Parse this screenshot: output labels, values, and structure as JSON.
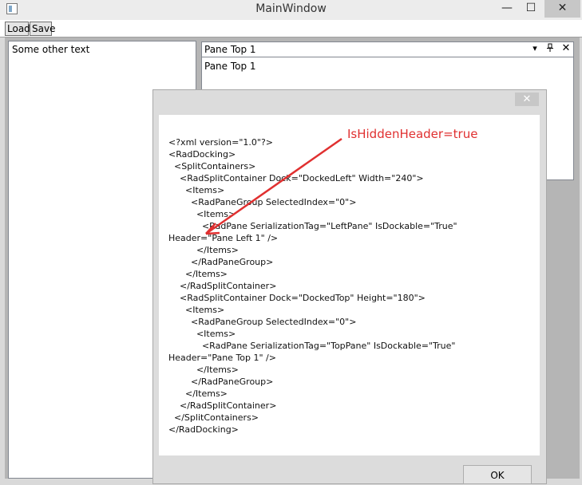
{
  "window": {
    "title": "MainWindow",
    "minimize_glyph": "—",
    "maximize_glyph": "☐",
    "close_glyph": "✕"
  },
  "toolbar": {
    "load_label": "Load",
    "save_label": "Save"
  },
  "left_pane": {
    "text": "Some other text"
  },
  "top_pane": {
    "title": "Pane Top 1",
    "content": "Pane Top 1",
    "menu_glyph": "▾",
    "pin_glyph": "📌",
    "close_glyph": "✕"
  },
  "dialog": {
    "close_glyph": "✕",
    "xml": "<?xml version=\"1.0\"?>\n<RadDocking>\n  <SplitContainers>\n    <RadSplitContainer Dock=\"DockedLeft\" Width=\"240\">\n      <Items>\n        <RadPaneGroup SelectedIndex=\"0\">\n          <Items>\n            <RadPane SerializationTag=\"LeftPane\" IsDockable=\"True\" Header=\"Pane Left 1\" />\n          </Items>\n        </RadPaneGroup>\n      </Items>\n    </RadSplitContainer>\n    <RadSplitContainer Dock=\"DockedTop\" Height=\"180\">\n      <Items>\n        <RadPaneGroup SelectedIndex=\"0\">\n          <Items>\n            <RadPane SerializationTag=\"TopPane\" IsDockable=\"True\" Header=\"Pane Top 1\" />\n          </Items>\n        </RadPaneGroup>\n      </Items>\n    </RadSplitContainer>\n  </SplitContainers>\n</RadDocking>",
    "ok_label": "OK"
  },
  "annotation": {
    "label": "IsHiddenHeader=true",
    "color": "#e03030"
  }
}
